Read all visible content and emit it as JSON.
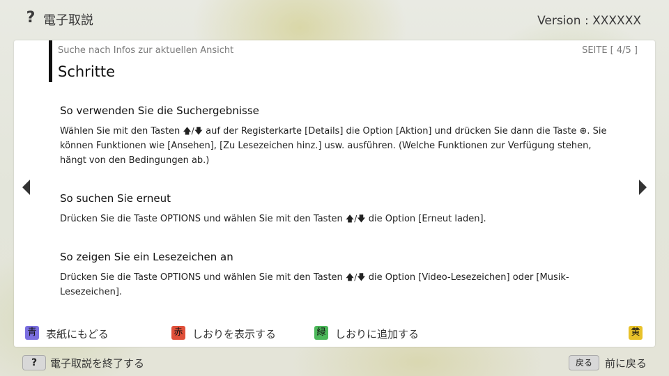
{
  "header": {
    "help_glyph": "?",
    "title": "電子取説",
    "version": "Version : XXXXXX"
  },
  "panel": {
    "breadcrumb": "Suche nach Infos zur aktuellen Ansicht",
    "page_indicator": "SEITE [ 4/5 ]",
    "title": "Schritte",
    "sections": [
      {
        "heading": "So verwenden Sie die Suchergebnisse",
        "body_1": "Wählen Sie mit den Tasten ",
        "arrows": "🡅/🡇",
        "body_2": " auf der Registerkarte [Details] die Option [Aktion] und drücken Sie dann die Taste ",
        "enter_glyph": "⊕",
        "body_3": ". Sie können Funktionen wie [Ansehen], [Zu Lesezeichen hinz.] usw. ausführen. (Welche Funktionen zur Verfügung stehen, hängt von den Bedingungen ab.)"
      },
      {
        "heading": "So suchen Sie erneut",
        "body_1": "Drücken Sie die Taste OPTIONS und wählen Sie mit den Tasten ",
        "arrows": "🡅/🡇",
        "body_2": " die Option [Erneut laden]."
      },
      {
        "heading": "So zeigen Sie ein Lesezeichen an",
        "body_1": "Drücken Sie die Taste OPTIONS und wählen Sie mit den Tasten ",
        "arrows": "🡅/🡇",
        "body_2": " die Option [Video-Lesezeichen] oder [Musik-Lesezeichen]."
      }
    ]
  },
  "color_actions": [
    {
      "key": "青",
      "label": "表紙にもどる",
      "color": "#7b6fe0"
    },
    {
      "key": "赤",
      "label": "しおりを表示する",
      "color": "#e0503a"
    },
    {
      "key": "緑",
      "label": "しおりに追加する",
      "color": "#4cb85a"
    },
    {
      "key": "黄",
      "label": "",
      "color": "#e8c22a"
    }
  ],
  "footer": {
    "help_key": "?",
    "exit_label": "電子取説を終了する",
    "back_key": "戻る",
    "back_label": "前に戻る"
  },
  "icons": {
    "help": "question-mark-icon",
    "prev": "triangle-left-icon",
    "next": "triangle-right-icon"
  }
}
